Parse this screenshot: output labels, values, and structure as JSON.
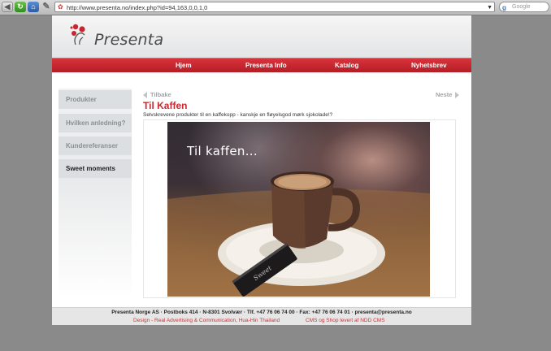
{
  "browser": {
    "address": "http://www.presenta.no/index.php?id=94,163,0,0,1,0",
    "search_placeholder": "Google"
  },
  "header": {
    "logo_text": "Presenta"
  },
  "nav": {
    "items": [
      "Hjem",
      "Presenta Info",
      "Katalog",
      "Nyhetsbrev"
    ]
  },
  "sidebar": {
    "items": [
      "Produkter",
      "Hvilken anledning?",
      "Kundereferanser",
      "Sweet moments"
    ]
  },
  "content": {
    "back_label": "Tilbake",
    "next_label": "Neste",
    "title": "Til Kaffen",
    "subtitle": "Selvskrevene produkter til en kaffekopp - kanskje en fløyelsgod mørk sjokolade!?",
    "photo_caption": "Til kaffen...",
    "chocolate_label": "Sweet"
  },
  "footer": {
    "address": "Presenta Norge AS  ·  Postboks 414  ·  N-8301 Svolvær  ·  Tlf. +47 76 06 74 00  ·  Fax: +47 76 06 74 01  ·  presenta@presenta.no",
    "credit_design": "Design - Real Advertising & Communication, Hua-Hin Thailand",
    "credit_cms": "CMS og Shop levert af NDD CMS"
  },
  "colors": {
    "brand_red": "#c82a31",
    "nav_red": "#c8262e",
    "sidebar_gray": "#dcdfe1"
  }
}
